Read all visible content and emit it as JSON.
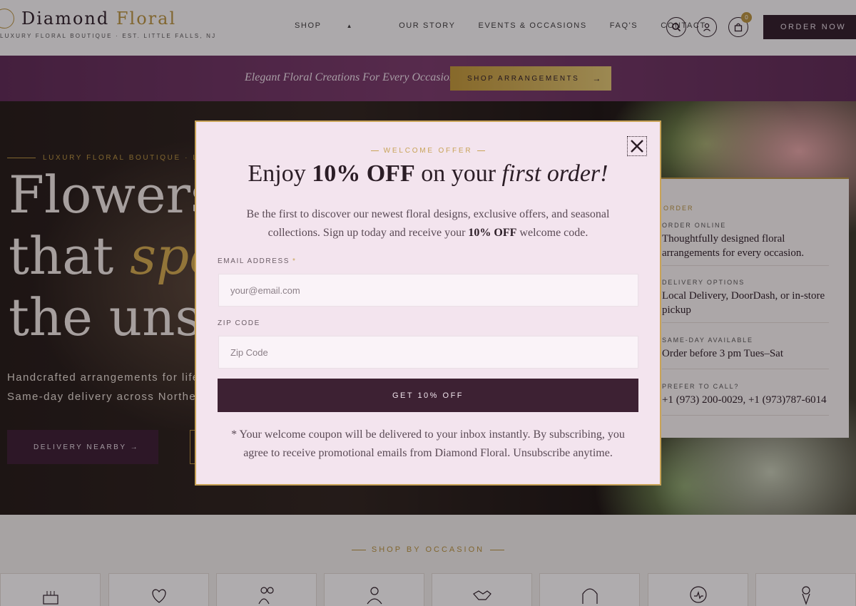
{
  "header": {
    "logo_name_main": "Diamond",
    "logo_name_accent": "Floral",
    "logo_tagline": "Luxury Floral Boutique · Est. Little Falls, NJ",
    "nav": [
      "SHOP",
      "OUR STORY",
      "EVENTS & OCCASIONS",
      "FAQ'S",
      "CONTACT"
    ],
    "cart_count": "0",
    "order_now": "ORDER NOW"
  },
  "promo": {
    "text": "Elegant Floral Creations For Every Occasion",
    "button": "SHOP ARRANGEMENTS",
    "button_arrow": "→"
  },
  "hero": {
    "eyebrow": "LUXURY FLORAL BOUTIQUE · LITTLE FALLS, NJ",
    "title_line1": "Flowers",
    "title_line2_a": "that",
    "title_line2_b": "speak",
    "title_line3": "the unspoken",
    "subtitle_line1": "Handcrafted arrangements for life's",
    "subtitle_line2": "Same-day delivery across Northern",
    "cta": "DELIVERY NEARBY →"
  },
  "info_card": {
    "heading": "ORDER",
    "items": [
      {
        "label": "Order online",
        "value": "Thoughtfully designed floral arrangements for every occasion."
      },
      {
        "label": "Delivery options",
        "value": "Local Delivery, DoorDash, or in-store pickup"
      },
      {
        "label": "Same-day available",
        "value": "Order before 3 pm Tues–Sat"
      },
      {
        "label": "Prefer to call?",
        "value": "+1 (973) 200-0029, +1 (973)787-6014"
      }
    ]
  },
  "occasions": {
    "title": "SHOP BY OCCASION",
    "icons": [
      "birthday-cake-icon",
      "hearts-icon",
      "couple-icon",
      "family-icon",
      "handshake-icon",
      "wedding-arch-icon",
      "get-well-icon",
      "bouquet-icon"
    ]
  },
  "modal": {
    "eyebrow": "WELCOME OFFER",
    "title_pre": "Enjoy ",
    "title_bold": "10% OFF",
    "title_mid": " on your ",
    "title_italic": "first order!",
    "desc_text": "Be the first to discover our newest floral designs, exclusive offers, and seasonal collections. Sign up today and receive your ",
    "desc_bold": "10% OFF",
    "desc_end": " welcome code.",
    "email_label": "EMAIL ADDRESS",
    "email_required": "*",
    "email_placeholder": "your@email.com",
    "email_value": "",
    "zip_label": "ZIP CODE",
    "zip_placeholder": "Zip Code",
    "zip_value": "",
    "submit": "GET 10% OFF",
    "disclaimer": "* Your welcome coupon will be delivered to your inbox instantly. By subscribing, you agree to receive promotional emails from Diamond Floral. Unsubscribe anytime."
  },
  "colors": {
    "accent_gold": "#b9953f",
    "plum": "#3d2133",
    "modal_bg": "#f3e4ee"
  }
}
